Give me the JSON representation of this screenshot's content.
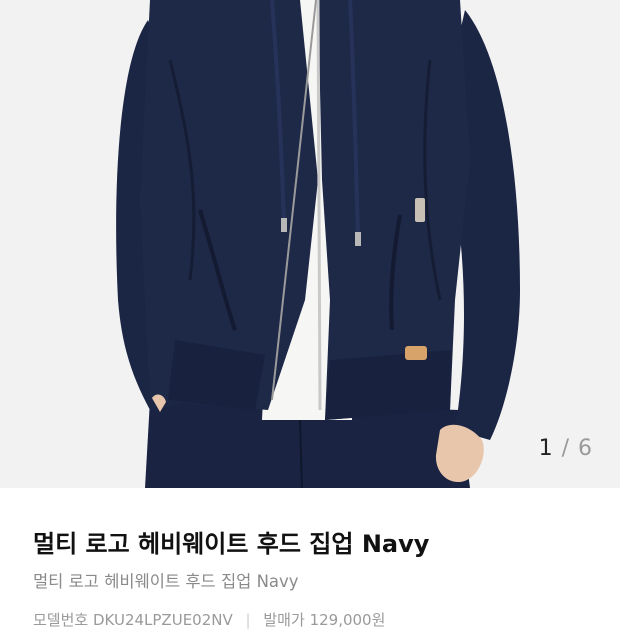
{
  "gallery": {
    "image_alt": "멀티 로고 헤비웨이트 후드 집업 Navy",
    "current": "1",
    "separator": "/",
    "total": "6",
    "colors": {
      "navy": "#1d2847",
      "navy_dark": "#141c33",
      "shirt": "#f6f6f4",
      "background": "#f2f2f2"
    }
  },
  "product": {
    "title": "멀티 로고 헤비웨이트 후드 집업 Navy",
    "subtitle": "멀티 로고 헤비웨이트 후드 집업 Navy",
    "model_label": "모델번호",
    "model_value": "DKU24LPZUE02NV",
    "release_label": "발매가",
    "release_value": "129,000원"
  }
}
